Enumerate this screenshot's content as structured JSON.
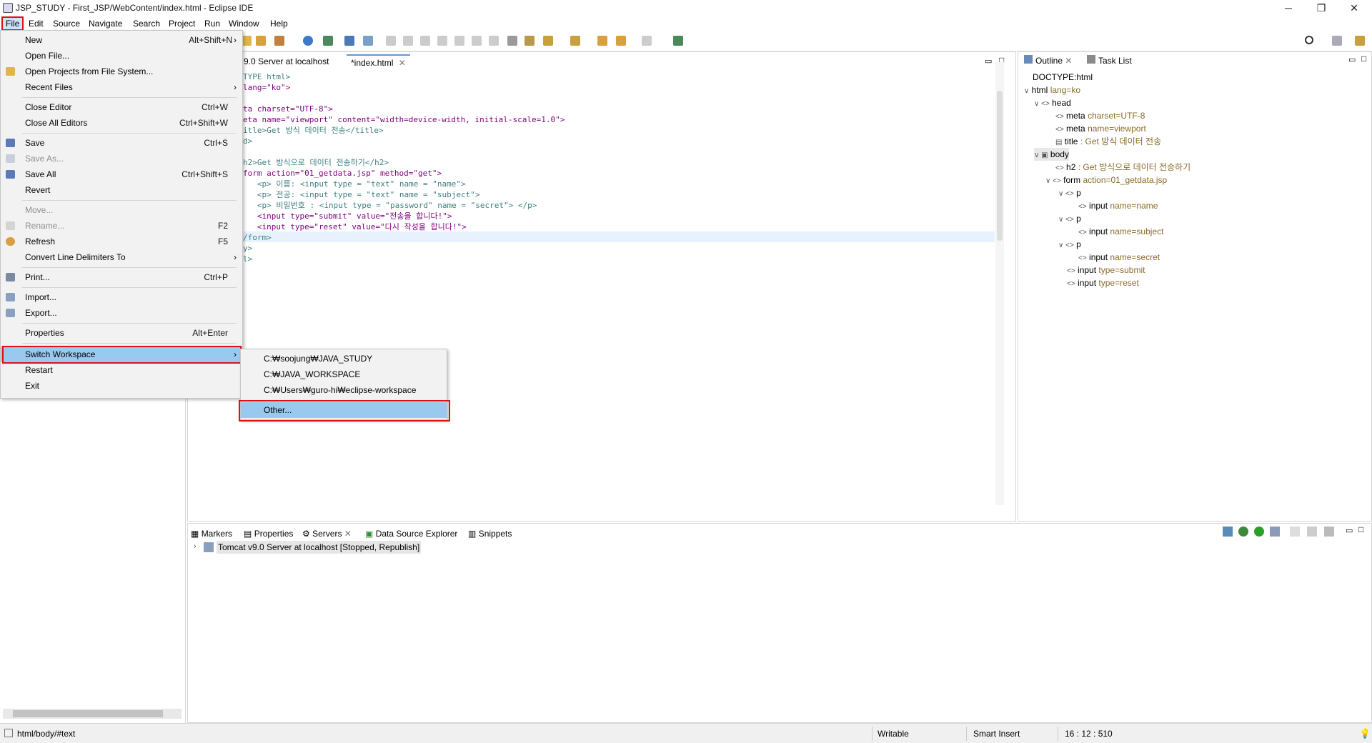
{
  "window": {
    "title": "JSP_STUDY - First_JSP/WebContent/index.html - Eclipse IDE",
    "minimize": "─",
    "restore": "❐",
    "close": "✕"
  },
  "menubar": [
    "File",
    "Edit",
    "Source",
    "Navigate",
    "Search",
    "Project",
    "Run",
    "Window",
    "Help"
  ],
  "editor": {
    "tabs": [
      {
        "label": "9.0 Server at localhost"
      },
      {
        "label": "*index.html",
        "active": true
      }
    ],
    "lines": [
      "TYPE html>",
      "lang=\"ko\">",
      "",
      "ta charset=\"UTF-8\">",
      "eta name=\"viewport\" content=\"width=device-width, initial-scale=1.0\">",
      "itle>Get 방식 데이터 전송</title>",
      "d>",
      "",
      "h2>Get 방식으로 데이터 전송하기</h2>",
      "form action=\"01_getdata.jsp\" method=\"get\">",
      "   <p> 이름: <input type = \"text\" name = \"name\">",
      "   <p> 전공: <input type = \"text\" name = \"subject\">",
      "   <p> 비밀번호 : <input type = \"password\" name = \"secret\"> </p>",
      "   <input type=\"submit\" value=\"전송을 합니다!\">",
      "   <input type=\"reset\" value=\"다시 작성을 합니다!\">",
      "/form>",
      "y>",
      "l>"
    ]
  },
  "outline": {
    "tabs": [
      "Outline",
      "Task List"
    ],
    "nodes": [
      {
        "key": "DOCTYPE:html",
        "val": ""
      },
      {
        "key": "html",
        "val": "lang=ko"
      },
      {
        "key": "head",
        "val": ""
      },
      {
        "key": "meta",
        "val": "charset=UTF-8"
      },
      {
        "key": "meta",
        "val": "name=viewport"
      },
      {
        "key": "title",
        "val": ": Get 방식 데이터 전송"
      },
      {
        "key": "body",
        "val": ""
      },
      {
        "key": "h2",
        "val": ": Get 방식으로 데이터 전송하기"
      },
      {
        "key": "form",
        "val": "action=01_getdata.jsp"
      },
      {
        "key": "p",
        "val": ""
      },
      {
        "key": "input",
        "val": "name=name"
      },
      {
        "key": "p",
        "val": ""
      },
      {
        "key": "input",
        "val": "name=subject"
      },
      {
        "key": "p",
        "val": ""
      },
      {
        "key": "input",
        "val": "name=secret"
      },
      {
        "key": "input",
        "val": "type=submit"
      },
      {
        "key": "input",
        "val": "type=reset"
      }
    ]
  },
  "bottom": {
    "tabs": [
      "Markers",
      "Properties",
      "Servers",
      "Data Source Explorer",
      "Snippets"
    ],
    "server_entry": "Tomcat v9.0 Server at localhost  [Stopped, Republish]"
  },
  "status": {
    "path": "html/body/#text",
    "writable": "Writable",
    "insert_mode": "Smart Insert",
    "position": "16 : 12 : 510"
  },
  "file_menu": {
    "items": [
      {
        "label": "New",
        "shortcut": "Alt+Shift+N",
        "arrow": "›"
      },
      {
        "label": "Open File...",
        "shortcut": ""
      },
      {
        "label": "Open Projects from File System...",
        "shortcut": ""
      },
      {
        "label": "Recent Files",
        "shortcut": "",
        "arrow": "›"
      },
      {
        "label": "Close Editor",
        "shortcut": "Ctrl+W"
      },
      {
        "label": "Close All Editors",
        "shortcut": "Ctrl+Shift+W"
      },
      {
        "label": "Save",
        "shortcut": "Ctrl+S"
      },
      {
        "label": "Save As...",
        "shortcut": "",
        "disabled": true
      },
      {
        "label": "Save All",
        "shortcut": "Ctrl+Shift+S"
      },
      {
        "label": "Revert",
        "shortcut": ""
      },
      {
        "label": "Move...",
        "shortcut": "",
        "disabled": true
      },
      {
        "label": "Rename...",
        "shortcut": "F2",
        "disabled": true
      },
      {
        "label": "Refresh",
        "shortcut": "F5"
      },
      {
        "label": "Convert Line Delimiters To",
        "shortcut": "",
        "arrow": "›"
      },
      {
        "label": "Print...",
        "shortcut": "Ctrl+P"
      },
      {
        "label": "Import...",
        "shortcut": ""
      },
      {
        "label": "Export...",
        "shortcut": ""
      },
      {
        "label": "Properties",
        "shortcut": "Alt+Enter"
      },
      {
        "label": "Switch Workspace",
        "shortcut": "",
        "arrow": "›",
        "highlighted": true
      },
      {
        "label": "Restart",
        "shortcut": ""
      },
      {
        "label": "Exit",
        "shortcut": ""
      }
    ]
  },
  "switch_workspace_submenu": {
    "items": [
      "C:₩soojung₩JAVA_STUDY",
      "C:₩JAVA_WORKSPACE",
      "C:₩Users₩guro-hi₩eclipse-workspace",
      "Other..."
    ]
  }
}
